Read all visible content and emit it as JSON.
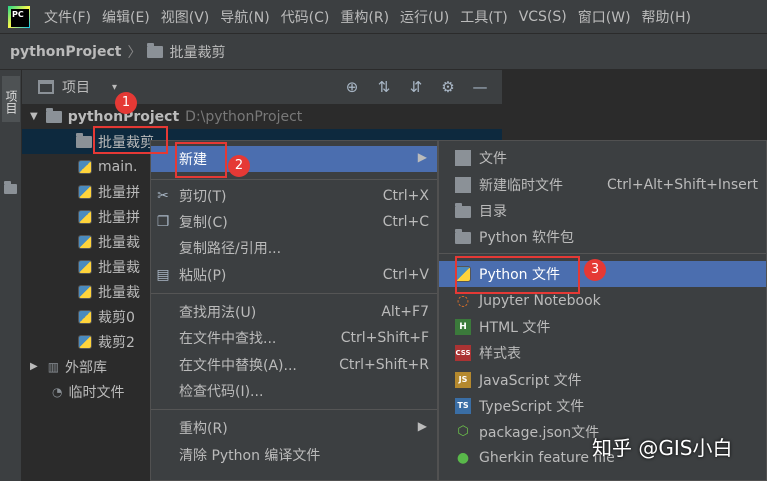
{
  "menubar": {
    "logo_text": "PC",
    "items": [
      "文件(F)",
      "编辑(E)",
      "视图(V)",
      "导航(N)",
      "代码(C)",
      "重构(R)",
      "运行(U)",
      "工具(T)",
      "VCS(S)",
      "窗口(W)",
      "帮助(H)"
    ]
  },
  "breadcrumb": {
    "project": "pythonProject",
    "separator": "〉",
    "folder": "批量裁剪"
  },
  "side_strip": {
    "tab_label": "项目"
  },
  "project_panel": {
    "title": "项目",
    "caret": "▾",
    "tools": [
      "⊕",
      "⇅",
      "⇵",
      "⚙",
      "—"
    ]
  },
  "tree": {
    "root_name": "pythonProject",
    "root_path": "D:\\pythonProject",
    "selected_folder": "批量裁剪",
    "files": [
      "main.",
      "批量拼",
      "批量拼",
      "批量裁",
      "批量裁",
      "批量裁",
      "裁剪0",
      "裁剪2"
    ],
    "external_libs": "外部库",
    "scratches": "临时文件"
  },
  "context_menu": {
    "items": [
      {
        "label": "新建",
        "shortcut": "",
        "icon": ""
      },
      {
        "label": "剪切(T)",
        "shortcut": "Ctrl+X",
        "icon": "scissors-icon"
      },
      {
        "label": "复制(C)",
        "shortcut": "Ctrl+C",
        "icon": "copy-icon"
      },
      {
        "label": "复制路径/引用...",
        "shortcut": "",
        "icon": ""
      },
      {
        "label": "粘贴(P)",
        "shortcut": "Ctrl+V",
        "icon": "clipboard-icon"
      },
      {
        "label": "查找用法(U)",
        "shortcut": "Alt+F7",
        "icon": ""
      },
      {
        "label": "在文件中查找...",
        "shortcut": "Ctrl+Shift+F",
        "icon": ""
      },
      {
        "label": "在文件中替换(A)...",
        "shortcut": "Ctrl+Shift+R",
        "icon": ""
      },
      {
        "label": "检查代码(I)...",
        "shortcut": "",
        "icon": ""
      },
      {
        "label": "重构(R)",
        "shortcut": "",
        "icon": ""
      },
      {
        "label": "清除 Python 编译文件",
        "shortcut": "",
        "icon": ""
      }
    ]
  },
  "submenu": {
    "items": [
      {
        "label": "文件",
        "shortcut": "",
        "icon": "file-icon"
      },
      {
        "label": "新建临时文件",
        "shortcut": "Ctrl+Alt+Shift+Insert",
        "icon": "scratch-file-icon"
      },
      {
        "label": "目录",
        "shortcut": "",
        "icon": "folder-icon"
      },
      {
        "label": "Python 软件包",
        "shortcut": "",
        "icon": "package-icon"
      },
      {
        "label": "Python 文件",
        "shortcut": "",
        "icon": "python-file-icon"
      },
      {
        "label": "Jupyter Notebook",
        "shortcut": "",
        "icon": "jupyter-icon"
      },
      {
        "label": "HTML 文件",
        "shortcut": "",
        "icon": "html-icon"
      },
      {
        "label": "样式表",
        "shortcut": "",
        "icon": "css-icon"
      },
      {
        "label": "JavaScript 文件",
        "shortcut": "",
        "icon": "js-icon"
      },
      {
        "label": "TypeScript 文件",
        "shortcut": "",
        "icon": "ts-icon"
      },
      {
        "label": "package.json文件",
        "shortcut": "",
        "icon": "nodejs-icon"
      },
      {
        "label": "Gherkin feature file",
        "shortcut": "",
        "icon": "gherkin-icon"
      }
    ]
  },
  "annotations": {
    "badge1": "1",
    "badge2": "2",
    "badge3": "3"
  },
  "watermark": "知乎 @GIS小白",
  "colors": {
    "selection": "#4b6eaf",
    "annotation": "#e53935",
    "background": "#2b2b2b",
    "panel": "#3c3f41"
  }
}
